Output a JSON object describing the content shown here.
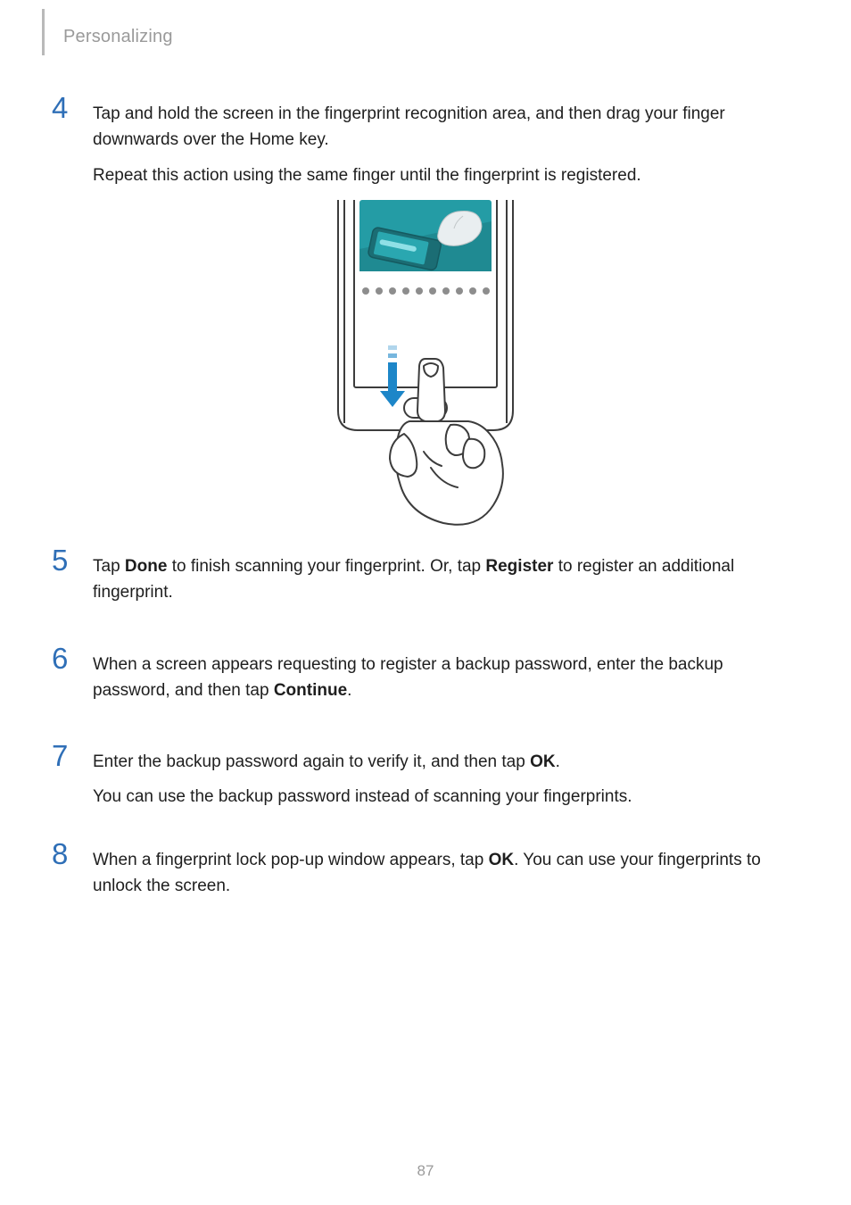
{
  "header": {
    "section": "Personalizing"
  },
  "steps": {
    "s4": {
      "num": "4",
      "p1": "Tap and hold the screen in the fingerprint recognition area, and then drag your finger downwards over the Home key.",
      "p2": "Repeat this action using the same finger until the fingerprint is registered."
    },
    "s5": {
      "num": "5",
      "p1_a": "Tap ",
      "p1_b": "Done",
      "p1_c": " to finish scanning your fingerprint. Or, tap ",
      "p1_d": "Register",
      "p1_e": " to register an additional fingerprint."
    },
    "s6": {
      "num": "6",
      "p1_a": "When a screen appears requesting to register a backup password, enter the backup password, and then tap ",
      "p1_b": "Continue",
      "p1_c": "."
    },
    "s7": {
      "num": "7",
      "p1_a": "Enter the backup password again to verify it, and then tap ",
      "p1_b": "OK",
      "p1_c": ".",
      "p2": "You can use the backup password instead of scanning your fingerprints."
    },
    "s8": {
      "num": "8",
      "p1_a": "When a fingerprint lock pop-up window appears, tap ",
      "p1_b": "OK",
      "p1_c": ". You can use your fingerprints to unlock the screen."
    }
  },
  "page_number": "87",
  "illustration": {
    "name": "fingerprint-swipe-illustration",
    "dot_count": 10,
    "colors": {
      "teal": "#249ca5",
      "track": "#1c7c84",
      "finger_stroke": "#3c3c3c",
      "device_stroke": "#3c3c3c",
      "arrow": "#1d86c8",
      "dot": "#8d8d8d"
    }
  }
}
